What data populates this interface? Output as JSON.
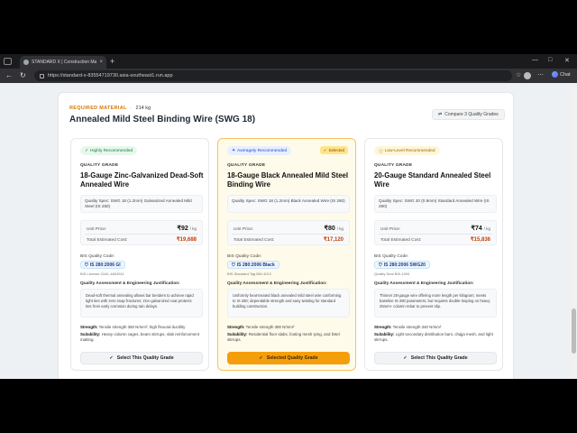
{
  "browser": {
    "tab_title": "STANDARD X | Construction Mate",
    "tab_close": "×",
    "new_tab": "+",
    "url": "https://standard-x-83554719730.asia-southeast1.run.app",
    "chat_label": "Chat",
    "minimize": "—",
    "maximize": "□",
    "close": "✕"
  },
  "header": {
    "required_label": "REQUIRED MATERIAL",
    "separator": "·",
    "quantity": "214 kg",
    "material_title": "Annealed Mild Steel Binding Wire (SWG 18)",
    "compare_button": "Compare 3 Quality Grades"
  },
  "cards": [
    {
      "badge": "Highly Recommended",
      "badge_color": "#15803d",
      "quality_grade_label": "QUALITY GRADE",
      "grade_name": "18-Gauge Zinc-Galvanized Dead-Soft Annealed Wire",
      "spec": "Quality Spec: SWG 18 (1.2mm) Galvanized Annealed Mild Steel (IS 280)",
      "unit_price_label": "Unit Price:",
      "unit_price": "₹92",
      "unit_per": "/ kg",
      "total_label": "Total Estimated Cost:",
      "total": "₹19,688",
      "bis_label": "BIS Quality Code:",
      "bis_code": "IS 280:2006 GI",
      "bis_sub": "BIS License CM/L-4824911",
      "qa_label": "Quality Assessment & Engineering Justification:",
      "qa_text": "Dead-soft thermal annealing allows bar benders to achieve rapid tight ties with zero snap fractures; zinc-galvanized coat protects ties from early corrosion during rain delays.",
      "strength_label": "Strength:",
      "strength": "Tensile strength 360 N/mm²; high flexural ductility",
      "suit_label": "Suitability:",
      "suit": "Heavy column cages, beam stirrups, slab reinforcement matting.",
      "button": "Select This Quality Grade",
      "selected": false
    },
    {
      "badge": "Averagely Recommended",
      "badge_color": "#1d4ed8",
      "selected_tag": "Selected",
      "quality_grade_label": "QUALITY GRADE",
      "grade_name": "18-Gauge Black Annealed Mild Steel Binding Wire",
      "spec": "Quality Spec: SWG 18 (1.2mm) Black Annealed Wire (IS 280)",
      "unit_price_label": "Unit Price:",
      "unit_price": "₹80",
      "unit_per": "/ kg",
      "total_label": "Total Estimated Cost:",
      "total": "₹17,120",
      "bis_label": "BIS Quality Code:",
      "bis_code": "IS 280:2006 Black",
      "bis_sub": "BIS Standard Tag BW-4012",
      "qa_label": "Quality Assessment & Engineering Justification:",
      "qa_text": "Uniformly heat-treated black annealed mild steel wire conforming to IS 280; dependable strength and easy twisting for standard building construction.",
      "strength_label": "Strength:",
      "strength": "Tensile strength 380 N/mm²",
      "suit_label": "Suitability:",
      "suit": "Residential floor slabs, footing mesh tying, and lintel stirrups.",
      "button": "Selected Quality Grade",
      "selected": true
    },
    {
      "badge": "Low-Level Recommended",
      "badge_color": "#a16207",
      "quality_grade_label": "QUALITY GRADE",
      "grade_name": "20-Gauge Standard Annealed Steel Wire",
      "spec": "Quality Spec: SWG 20 (0.9mm) Standard Annealed Wire (IS 280)",
      "unit_price_label": "Unit Price:",
      "unit_price": "₹74",
      "unit_per": "/ kg",
      "total_label": "Total Estimated Cost:",
      "total": "₹15,836",
      "bis_label": "BIS Quality Code:",
      "bis_code": "IS 280:2006 SWG20",
      "bis_sub": "Quality Seal BW-1094",
      "qa_label": "Quality Assessment & Engineering Justification:",
      "qa_text": "Thinner 20-gauge wire offering more length per kilogram; meets baseline IS 280 parameters, but requires double-looping on heavy 25mm+ column rebar to prevent slip.",
      "strength_label": "Strength:",
      "strength": "Tensile strength 340 N/mm²",
      "suit_label": "Suitability:",
      "suit": "Light secondary distribution bars, chajja mesh, and light stirrups.",
      "button": "Select This Quality Grade",
      "selected": false
    }
  ]
}
